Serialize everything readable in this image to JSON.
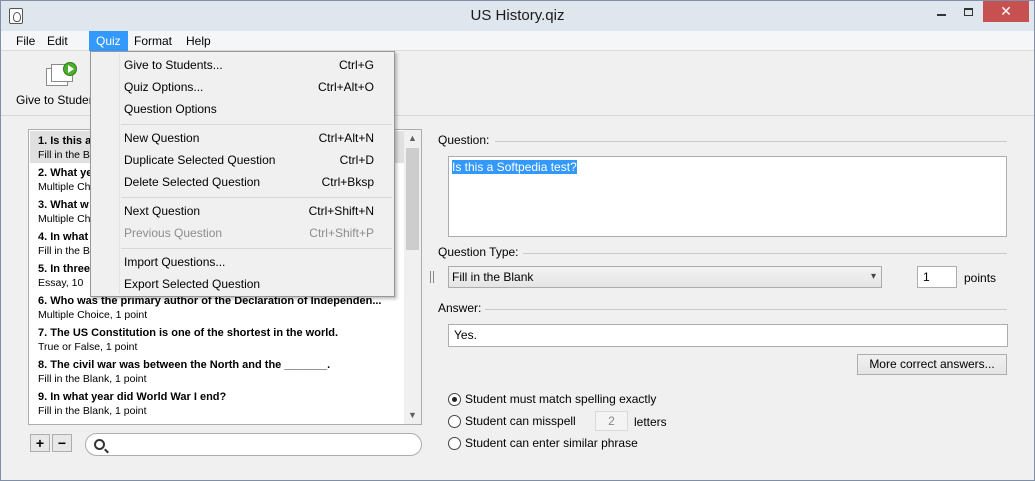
{
  "window": {
    "title": "US History.qiz",
    "close_glyph": "✕",
    "icon": "app-quiz-icon"
  },
  "menubar": {
    "items": [
      "File",
      "Edit",
      "Quiz",
      "Format",
      "Help"
    ],
    "active": "Quiz"
  },
  "toolbar": {
    "give_label": "Give to Studen"
  },
  "quiz_menu": {
    "items": [
      {
        "label": "Give to Students...",
        "shortcut": "Ctrl+G",
        "enabled": true
      },
      {
        "label": "Quiz Options...",
        "shortcut": "Ctrl+Alt+O",
        "enabled": true
      },
      {
        "label": "Question Options",
        "shortcut": "",
        "enabled": true
      },
      {
        "label": "New Question",
        "shortcut": "Ctrl+Alt+N",
        "enabled": true
      },
      {
        "label": "Duplicate Selected Question",
        "shortcut": "Ctrl+D",
        "enabled": true
      },
      {
        "label": "Delete Selected Question",
        "shortcut": "Ctrl+Bksp",
        "enabled": true
      },
      {
        "label": "Next Question",
        "shortcut": "Ctrl+Shift+N",
        "enabled": true
      },
      {
        "label": "Previous Question",
        "shortcut": "Ctrl+Shift+P",
        "enabled": false
      },
      {
        "label": "Import Questions...",
        "shortcut": "",
        "enabled": true
      },
      {
        "label": "Export Selected Question",
        "shortcut": "",
        "enabled": true
      }
    ]
  },
  "questions": [
    {
      "title": "1. Is this a",
      "sub": "Fill in the B"
    },
    {
      "title": "2. What ye",
      "sub": "Multiple Ch"
    },
    {
      "title": "3. What w",
      "sub": "Multiple Ch"
    },
    {
      "title": "4. In what",
      "sub": "Fill in the B"
    },
    {
      "title": "5. In three",
      "sub": "Essay, 10"
    },
    {
      "title": "6. Who was the primary author of the Declaration of Independen...",
      "sub": "Multiple Choice, 1 point"
    },
    {
      "title": "7. The US Constitution is one of the shortest in the world.",
      "sub": "True or False, 1 point"
    },
    {
      "title": "8. The civil war was between the North and the _______.",
      "sub": "Fill in the Blank, 1 point"
    },
    {
      "title": "9. In what year did World War I end?",
      "sub": "Fill in the Blank, 1 point"
    }
  ],
  "list_controls": {
    "add": "+",
    "remove": "−"
  },
  "scroll": {
    "up": "▲",
    "down": "▼"
  },
  "editor": {
    "question_label": "Question:",
    "question_text": "Is this a Softpedia test?",
    "type_label": "Question Type:",
    "type_value": "Fill in the Blank",
    "type_chevron": "▾",
    "points_value": "1",
    "points_label": "points",
    "answer_label": "Answer:",
    "answer_value": "Yes.",
    "more_answers_label": "More correct answers...",
    "radio_exact": "Student must match spelling exactly",
    "radio_misspell": "Student can misspell",
    "misspell_letters": "2",
    "letters_label": "letters",
    "radio_similar": "Student can enter similar phrase"
  }
}
